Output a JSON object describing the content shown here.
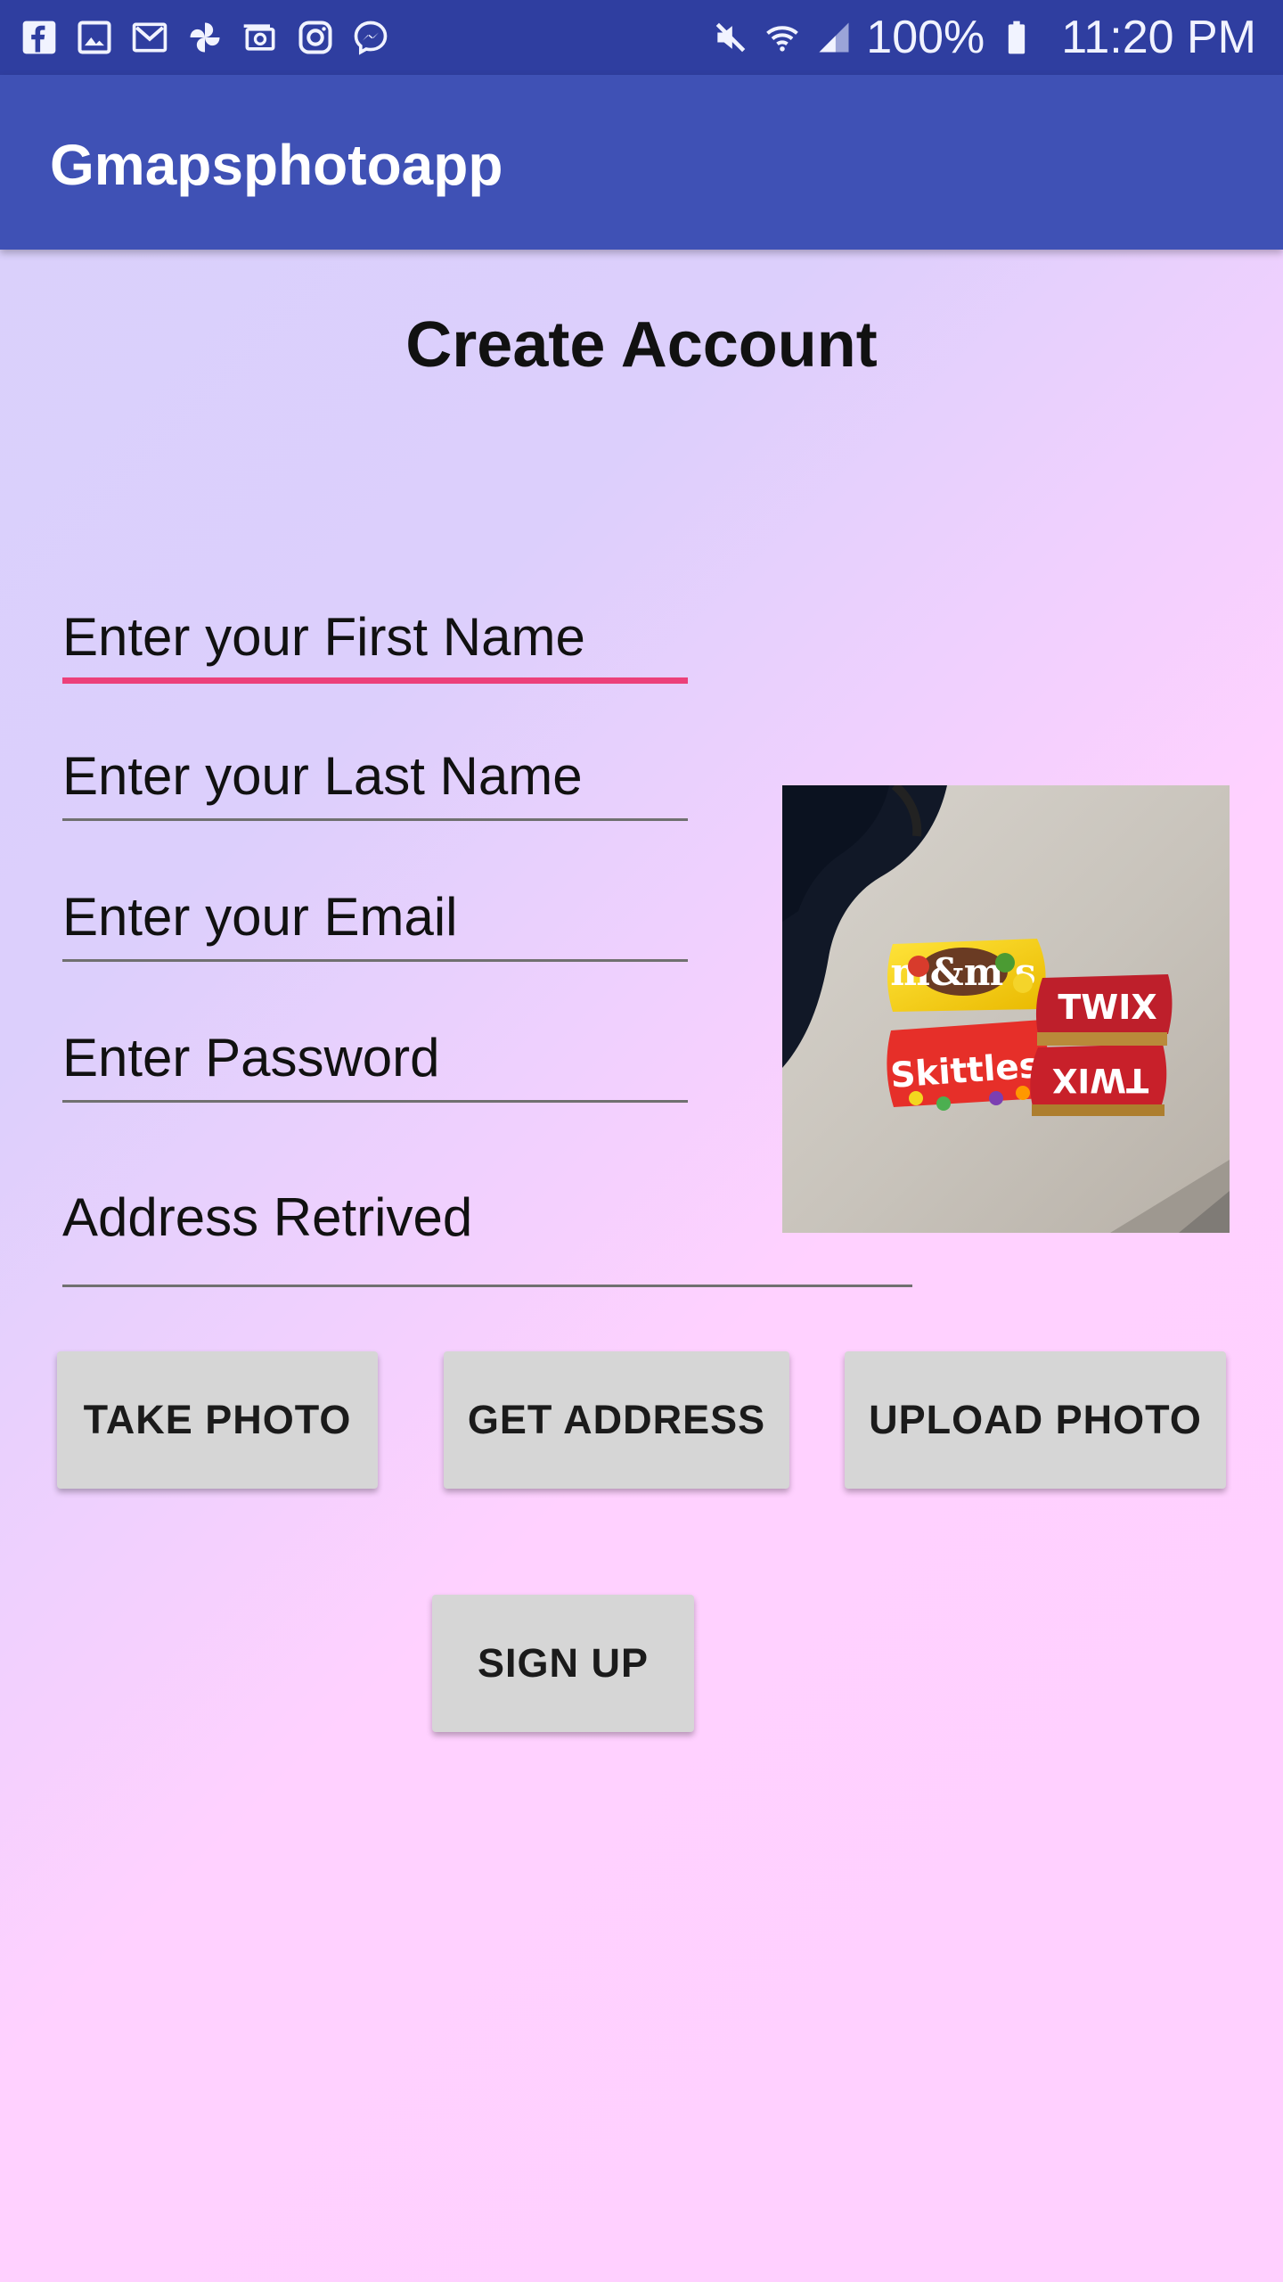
{
  "status_bar": {
    "left_icons": [
      "facebook-icon",
      "image-icon",
      "gmail-icon",
      "pinwheel-icon",
      "email-app-icon",
      "instagram-icon",
      "messenger-icon"
    ],
    "right_icons": [
      "mute-icon",
      "wifi-icon",
      "signal-icon",
      "battery-icon"
    ],
    "battery": "100%",
    "time": "11:20 PM"
  },
  "app_bar": {
    "title": "Gmapsphotoapp"
  },
  "form": {
    "title": "Create Account",
    "first_name_placeholder": "Enter your First Name",
    "last_name_placeholder": "Enter your Last Name",
    "email_placeholder": "Enter your Email",
    "password_placeholder": "Enter Password",
    "address_label": "Address Retrived",
    "focused_field": "first_name"
  },
  "photo": {
    "visible_brand_text": [
      "m&m's",
      "Skittles",
      "TWIX"
    ]
  },
  "buttons": {
    "take_photo": "TAKE PHOTO",
    "get_address": "GET ADDRESS",
    "upload_photo": "UPLOAD PHOTO",
    "sign_up": "SIGN UP"
  },
  "colors": {
    "status_bar": "#2f3ea0",
    "app_bar": "#3f51b5",
    "focused_underline": "#ec407a",
    "button": "#d6d6d6"
  }
}
